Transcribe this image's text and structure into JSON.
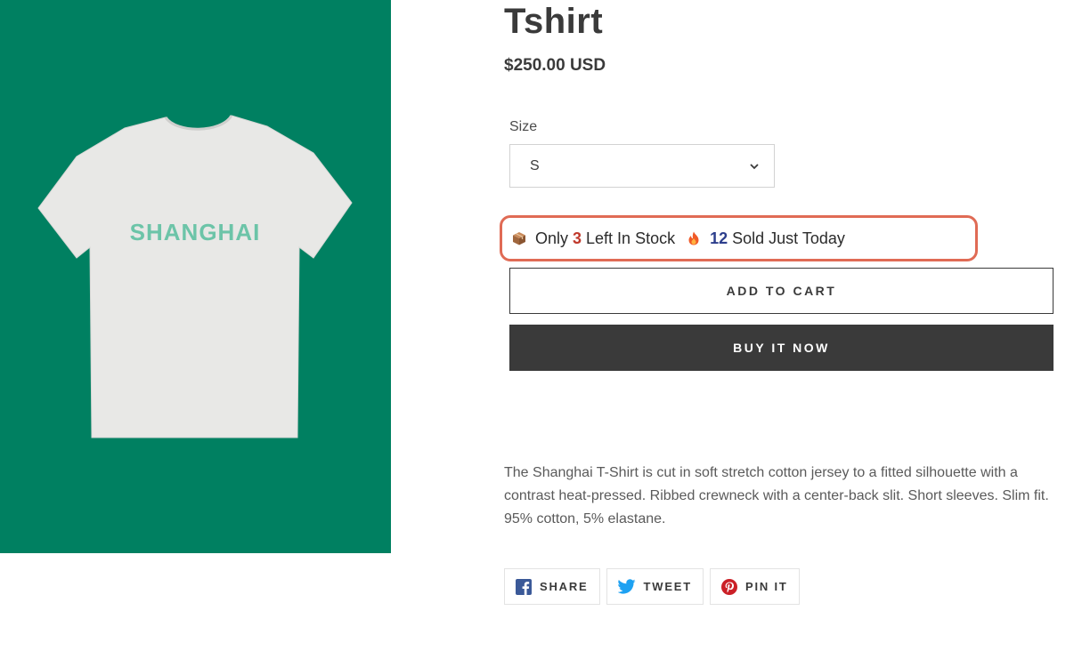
{
  "product": {
    "title": "Tshirt",
    "price": "$250.00 USD",
    "image_text": "SHANGHAI",
    "description": "The Shanghai T-Shirt is cut in soft stretch cotton jersey to a fitted silhouette with a contrast heat-pressed. Ribbed crewneck with a center-back slit. Short sleeves. Slim fit. 95% cotton, 5% elastane."
  },
  "size": {
    "label": "Size",
    "selected": "S"
  },
  "urgency": {
    "stock_prefix": "Only",
    "stock_count": "3",
    "stock_suffix": "Left In Stock",
    "sold_count": "12",
    "sold_suffix": "Sold Just Today",
    "highlight_color": "#e06b55"
  },
  "actions": {
    "add_to_cart": "ADD TO CART",
    "buy_now": "BUY IT NOW"
  },
  "share": {
    "facebook": "SHARE",
    "twitter": "TWEET",
    "pinterest": "PIN IT"
  },
  "colors": {
    "image_bg": "#008061",
    "tshirt": "#e8e8e6",
    "print": "#6cc4a8",
    "buy_button": "#3a3a3a",
    "facebook": "#3b5998",
    "twitter": "#1da1f2",
    "pinterest": "#cb2027"
  }
}
